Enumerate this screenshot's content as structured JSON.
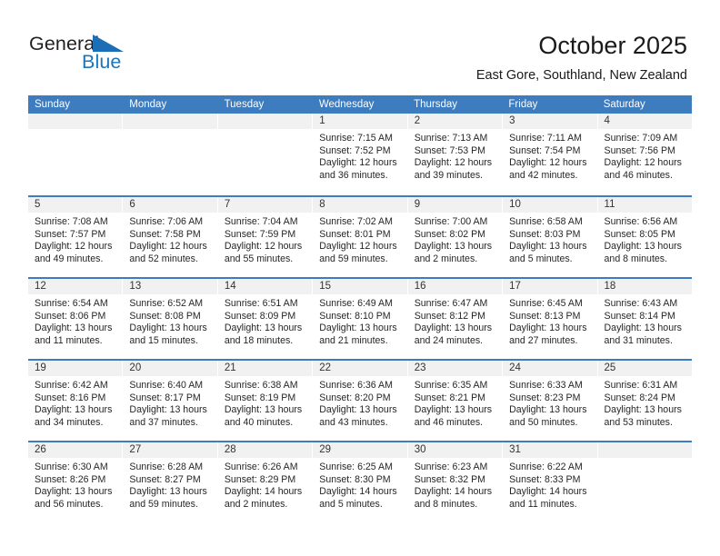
{
  "brand": {
    "name_part1": "General",
    "name_part2": "Blue",
    "flag_icon": "triangle-flag-icon"
  },
  "header": {
    "title": "October 2025",
    "subtitle": "East Gore, Southland, New Zealand"
  },
  "calendar": {
    "day_headers": [
      "Sunday",
      "Monday",
      "Tuesday",
      "Wednesday",
      "Thursday",
      "Friday",
      "Saturday"
    ],
    "accent_color": "#3c7cbf",
    "date_band_color": "#f1f1f1",
    "weeks": [
      [
        {
          "date": "",
          "lines": []
        },
        {
          "date": "",
          "lines": []
        },
        {
          "date": "",
          "lines": []
        },
        {
          "date": "1",
          "lines": [
            "Sunrise: 7:15 AM",
            "Sunset: 7:52 PM",
            "Daylight: 12 hours",
            "and 36 minutes."
          ]
        },
        {
          "date": "2",
          "lines": [
            "Sunrise: 7:13 AM",
            "Sunset: 7:53 PM",
            "Daylight: 12 hours",
            "and 39 minutes."
          ]
        },
        {
          "date": "3",
          "lines": [
            "Sunrise: 7:11 AM",
            "Sunset: 7:54 PM",
            "Daylight: 12 hours",
            "and 42 minutes."
          ]
        },
        {
          "date": "4",
          "lines": [
            "Sunrise: 7:09 AM",
            "Sunset: 7:56 PM",
            "Daylight: 12 hours",
            "and 46 minutes."
          ]
        }
      ],
      [
        {
          "date": "5",
          "lines": [
            "Sunrise: 7:08 AM",
            "Sunset: 7:57 PM",
            "Daylight: 12 hours",
            "and 49 minutes."
          ]
        },
        {
          "date": "6",
          "lines": [
            "Sunrise: 7:06 AM",
            "Sunset: 7:58 PM",
            "Daylight: 12 hours",
            "and 52 minutes."
          ]
        },
        {
          "date": "7",
          "lines": [
            "Sunrise: 7:04 AM",
            "Sunset: 7:59 PM",
            "Daylight: 12 hours",
            "and 55 minutes."
          ]
        },
        {
          "date": "8",
          "lines": [
            "Sunrise: 7:02 AM",
            "Sunset: 8:01 PM",
            "Daylight: 12 hours",
            "and 59 minutes."
          ]
        },
        {
          "date": "9",
          "lines": [
            "Sunrise: 7:00 AM",
            "Sunset: 8:02 PM",
            "Daylight: 13 hours",
            "and 2 minutes."
          ]
        },
        {
          "date": "10",
          "lines": [
            "Sunrise: 6:58 AM",
            "Sunset: 8:03 PM",
            "Daylight: 13 hours",
            "and 5 minutes."
          ]
        },
        {
          "date": "11",
          "lines": [
            "Sunrise: 6:56 AM",
            "Sunset: 8:05 PM",
            "Daylight: 13 hours",
            "and 8 minutes."
          ]
        }
      ],
      [
        {
          "date": "12",
          "lines": [
            "Sunrise: 6:54 AM",
            "Sunset: 8:06 PM",
            "Daylight: 13 hours",
            "and 11 minutes."
          ]
        },
        {
          "date": "13",
          "lines": [
            "Sunrise: 6:52 AM",
            "Sunset: 8:08 PM",
            "Daylight: 13 hours",
            "and 15 minutes."
          ]
        },
        {
          "date": "14",
          "lines": [
            "Sunrise: 6:51 AM",
            "Sunset: 8:09 PM",
            "Daylight: 13 hours",
            "and 18 minutes."
          ]
        },
        {
          "date": "15",
          "lines": [
            "Sunrise: 6:49 AM",
            "Sunset: 8:10 PM",
            "Daylight: 13 hours",
            "and 21 minutes."
          ]
        },
        {
          "date": "16",
          "lines": [
            "Sunrise: 6:47 AM",
            "Sunset: 8:12 PM",
            "Daylight: 13 hours",
            "and 24 minutes."
          ]
        },
        {
          "date": "17",
          "lines": [
            "Sunrise: 6:45 AM",
            "Sunset: 8:13 PM",
            "Daylight: 13 hours",
            "and 27 minutes."
          ]
        },
        {
          "date": "18",
          "lines": [
            "Sunrise: 6:43 AM",
            "Sunset: 8:14 PM",
            "Daylight: 13 hours",
            "and 31 minutes."
          ]
        }
      ],
      [
        {
          "date": "19",
          "lines": [
            "Sunrise: 6:42 AM",
            "Sunset: 8:16 PM",
            "Daylight: 13 hours",
            "and 34 minutes."
          ]
        },
        {
          "date": "20",
          "lines": [
            "Sunrise: 6:40 AM",
            "Sunset: 8:17 PM",
            "Daylight: 13 hours",
            "and 37 minutes."
          ]
        },
        {
          "date": "21",
          "lines": [
            "Sunrise: 6:38 AM",
            "Sunset: 8:19 PM",
            "Daylight: 13 hours",
            "and 40 minutes."
          ]
        },
        {
          "date": "22",
          "lines": [
            "Sunrise: 6:36 AM",
            "Sunset: 8:20 PM",
            "Daylight: 13 hours",
            "and 43 minutes."
          ]
        },
        {
          "date": "23",
          "lines": [
            "Sunrise: 6:35 AM",
            "Sunset: 8:21 PM",
            "Daylight: 13 hours",
            "and 46 minutes."
          ]
        },
        {
          "date": "24",
          "lines": [
            "Sunrise: 6:33 AM",
            "Sunset: 8:23 PM",
            "Daylight: 13 hours",
            "and 50 minutes."
          ]
        },
        {
          "date": "25",
          "lines": [
            "Sunrise: 6:31 AM",
            "Sunset: 8:24 PM",
            "Daylight: 13 hours",
            "and 53 minutes."
          ]
        }
      ],
      [
        {
          "date": "26",
          "lines": [
            "Sunrise: 6:30 AM",
            "Sunset: 8:26 PM",
            "Daylight: 13 hours",
            "and 56 minutes."
          ]
        },
        {
          "date": "27",
          "lines": [
            "Sunrise: 6:28 AM",
            "Sunset: 8:27 PM",
            "Daylight: 13 hours",
            "and 59 minutes."
          ]
        },
        {
          "date": "28",
          "lines": [
            "Sunrise: 6:26 AM",
            "Sunset: 8:29 PM",
            "Daylight: 14 hours",
            "and 2 minutes."
          ]
        },
        {
          "date": "29",
          "lines": [
            "Sunrise: 6:25 AM",
            "Sunset: 8:30 PM",
            "Daylight: 14 hours",
            "and 5 minutes."
          ]
        },
        {
          "date": "30",
          "lines": [
            "Sunrise: 6:23 AM",
            "Sunset: 8:32 PM",
            "Daylight: 14 hours",
            "and 8 minutes."
          ]
        },
        {
          "date": "31",
          "lines": [
            "Sunrise: 6:22 AM",
            "Sunset: 8:33 PM",
            "Daylight: 14 hours",
            "and 11 minutes."
          ]
        },
        {
          "date": "",
          "lines": []
        }
      ]
    ]
  }
}
